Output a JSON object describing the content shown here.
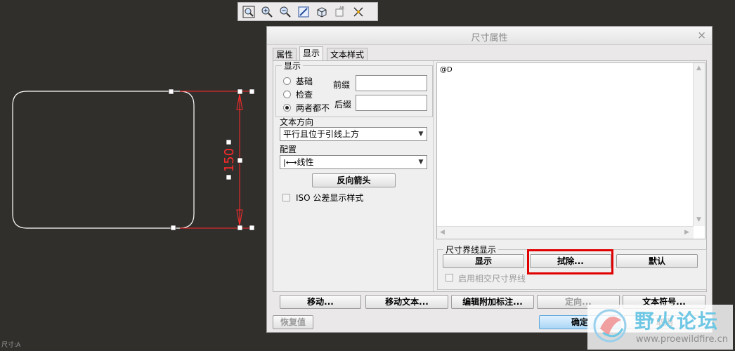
{
  "toolbar": {
    "icons": [
      "zoom-fit-icon",
      "zoom-in-icon",
      "zoom-out-icon",
      "repaint-icon",
      "display-style-icon",
      "annotation-display-icon",
      "datum-display-icon"
    ]
  },
  "canvas": {
    "dimension_value": "150",
    "status_text": "尺寸:A"
  },
  "dialog": {
    "title": "尺寸属性",
    "close": "×",
    "tabs": [
      "属性",
      "显示",
      "文本样式"
    ],
    "active_tab": "显示",
    "display_group": {
      "legend": "显示",
      "radios": [
        "基础",
        "检查",
        "两者都不"
      ],
      "selected_radio": "两者都不",
      "prefix_label": "前缀",
      "prefix_value": "",
      "suffix_label": "后缀",
      "suffix_value": ""
    },
    "text_orientation_label": "文本方向",
    "text_orientation_value": "平行且位于引线上方",
    "placement_label": "配置",
    "placement_value": "线性",
    "flip_arrows_button": "反向箭头",
    "iso_checkbox_label": "ISO 公差显示样式",
    "text_content": "@D",
    "witness_group": {
      "legend": "尺寸界线显示",
      "show_button": "显示",
      "erase_button": "拭除...",
      "default_button": "默认",
      "intersect_checkbox_label": "启用相交尺寸界线"
    },
    "bottom_buttons": {
      "move": "移动...",
      "move_text": "移动文本...",
      "edit_attach": "编辑附加标注...",
      "orient": "定向...",
      "text_symbol": "文本符号...",
      "restore": "恢复值",
      "ok": "确定",
      "cancel": "取消"
    },
    "highlight_color": "#e00000"
  },
  "watermark": {
    "text": "野火论坛",
    "url": "www.proewildfire.cn"
  }
}
